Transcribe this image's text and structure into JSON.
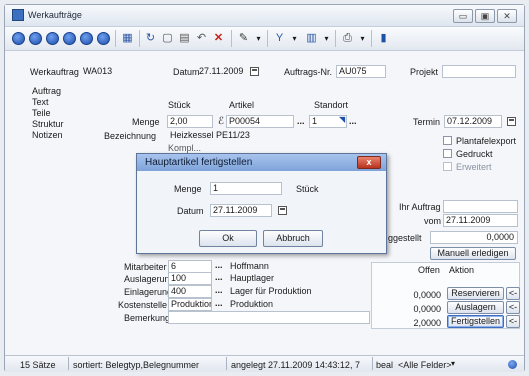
{
  "window": {
    "title": "Werkaufträge"
  },
  "header": {
    "werkauftrag_label": "Werkauftrag",
    "werkauftrag_value": "WA013",
    "datum_label": "Datum",
    "datum_value": "27.11.2009",
    "auftragsnr_label": "Auftrags-Nr.",
    "auftragsnr_value": "AU075",
    "projekt_label": "Projekt",
    "projekt_value": ""
  },
  "sidebar": {
    "items": [
      {
        "label": "Auftrag"
      },
      {
        "label": "Text"
      },
      {
        "label": "Teile"
      },
      {
        "label": "Struktur"
      },
      {
        "label": "Notizen"
      }
    ]
  },
  "form": {
    "col_stueck": "Stück",
    "col_artikel": "Artikel",
    "col_standort": "Standort",
    "menge_label": "Menge",
    "menge_value": "2,00",
    "artikel_value": "P00054",
    "standort_value": "1",
    "termin_label": "Termin",
    "termin_value": "07.12.2009",
    "bezeichnung_label": "Bezeichnung",
    "bezeichnung_value": "Heizkessel PE11/23",
    "bezeichnung_line2": "Kompl...",
    "plantafelexport": "Plantafelexport",
    "gedruckt": "Gedruckt",
    "erweitert": "Erweitert",
    "ihr_auftrag_label": "Ihr Auftrag",
    "ihr_auftrag_value": "",
    "vom_label": "vom",
    "vom_value": "27.11.2009",
    "fertiggestellt_label": "ggestellt",
    "fertiggestellt_value": "0,0000",
    "manuell_erledigen": "Manuell erledigen"
  },
  "rows": [
    {
      "label": "Mitarbeiter",
      "value": "6",
      "text": "Hoffmann"
    },
    {
      "label": "Auslagerung",
      "value": "100",
      "text": "Hauptlager"
    },
    {
      "label": "Einlagerung",
      "value": "400",
      "text": "Lager für Produktion"
    },
    {
      "label": "Kostenstelle",
      "value": "Produktion",
      "text": "Produktion"
    },
    {
      "label": "Bemerkung",
      "value": "",
      "text": ""
    }
  ],
  "right_panel": {
    "offen": "Offen",
    "aktion": "Aktion",
    "actions": [
      {
        "value": "0,0000",
        "button": "Reservieren"
      },
      {
        "value": "0,0000",
        "button": "Auslagern"
      },
      {
        "value": "2,0000",
        "button": "Fertigstellen"
      }
    ],
    "small_button": "<-"
  },
  "dialog": {
    "title": "Hauptartikel fertigstellen",
    "menge_label": "Menge",
    "menge_value": "1",
    "unit": "Stück",
    "datum_label": "Datum",
    "datum_value": "27.11.2009",
    "ok": "Ok",
    "abbruch": "Abbruch",
    "close": "x"
  },
  "statusbar": {
    "count": "15 Sätze",
    "sort": "sortiert: Belegtyp,Belegnummer",
    "created": "angelegt 27.11.2009 14:43:12, 7",
    "edit": "beal",
    "filter": "<Alle Felder>"
  },
  "colors": {
    "accent": "#1d4ea8",
    "titlebar": "#dfe6ef",
    "dialog_title": "#7ea3d9"
  }
}
